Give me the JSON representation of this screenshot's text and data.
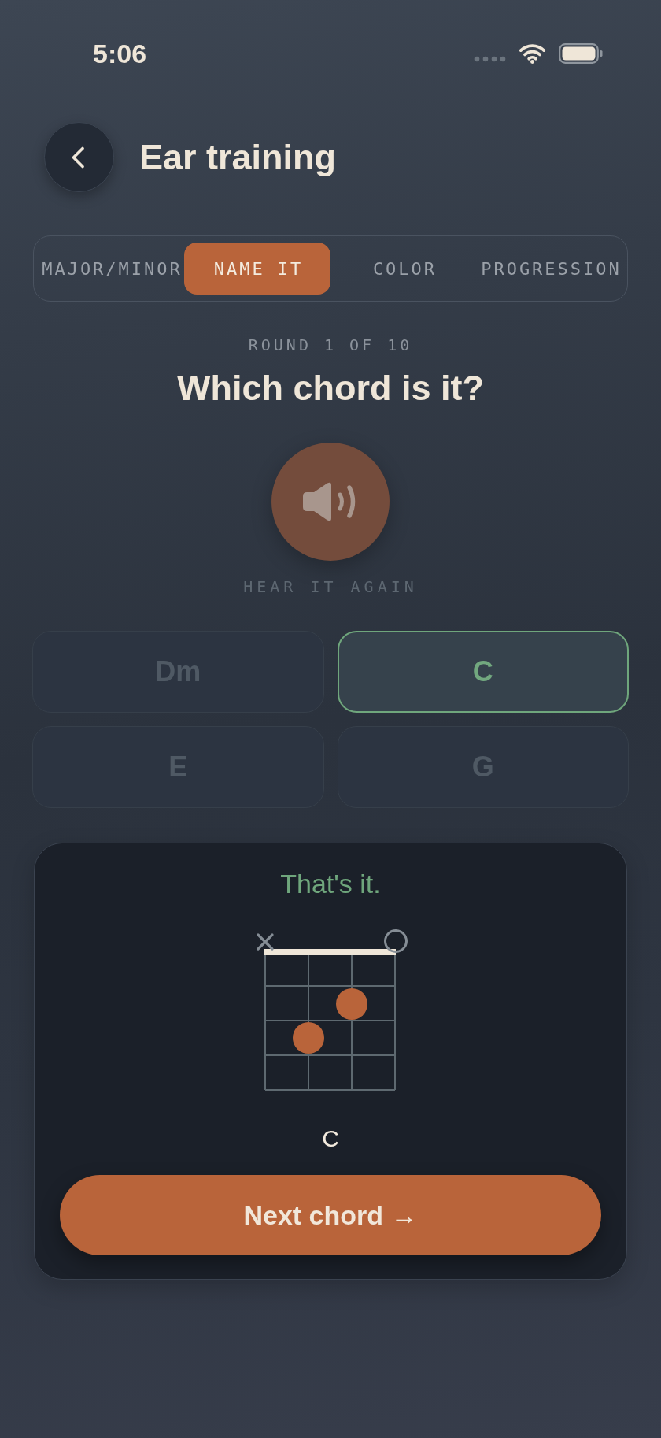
{
  "status_bar": {
    "time": "5:06"
  },
  "header": {
    "title": "Ear training"
  },
  "tabs": [
    {
      "label": "MAJOR/MINOR",
      "selected": false
    },
    {
      "label": "NAME IT",
      "selected": true
    },
    {
      "label": "COLOR",
      "selected": false
    },
    {
      "label": "PROGRESSION",
      "selected": false
    }
  ],
  "quiz": {
    "round": "ROUND 1 OF 10",
    "question": "Which chord is it?",
    "replay_label": "HEAR IT AGAIN"
  },
  "answers": [
    {
      "label": "Dm",
      "selected": false,
      "disabled": true
    },
    {
      "label": "C",
      "selected": true,
      "disabled": false
    },
    {
      "label": "E",
      "selected": false,
      "disabled": true
    },
    {
      "label": "G",
      "selected": false,
      "disabled": true
    }
  ],
  "feedback": {
    "message": "That's it.",
    "correct": true,
    "chord": "C",
    "button": "Next chord →"
  }
}
